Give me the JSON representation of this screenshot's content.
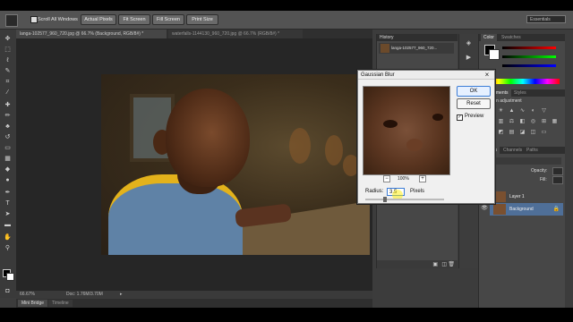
{
  "optionsBar": {
    "scroll_all_label": "Scroll All Windows",
    "buttons": [
      "Actual Pixels",
      "Fit Screen",
      "Fill Screen",
      "Print Size"
    ],
    "workspace": "Essentials"
  },
  "docTabs": [
    {
      "label": "langa-102577_960_720.jpg @ 66.7% (Background, RGB/8#) *"
    },
    {
      "label": "waterfalls-1144130_960_720.jpg @ 66.7% (RGB/8#) *"
    }
  ],
  "status": {
    "zoom": "66.67%",
    "doc": "Doc: 1.76M/3.70M"
  },
  "bottomTabs": [
    "Mini Bridge",
    "Timeline"
  ],
  "history": {
    "title": "History",
    "item": "langa-102577_960_720..."
  },
  "rightPanel": {
    "colorTabs": [
      "Color",
      "Swatches"
    ],
    "adjustTabs": [
      "Adjustments",
      "Styles"
    ],
    "adjustTitle": "Add an adjustment",
    "layerTabs": [
      "Layers",
      "Channels",
      "Paths"
    ],
    "opacity_label": "Opacity:",
    "fill_label": "Fill:",
    "layers": [
      "Layer 1",
      "Background"
    ]
  },
  "dialog": {
    "title": "Gaussian Blur",
    "ok": "OK",
    "reset": "Reset",
    "preview": "Preview",
    "zoom": "100%",
    "radius_label": "Radius:",
    "radius_value": "3.5",
    "radius_unit": "Pixels"
  }
}
